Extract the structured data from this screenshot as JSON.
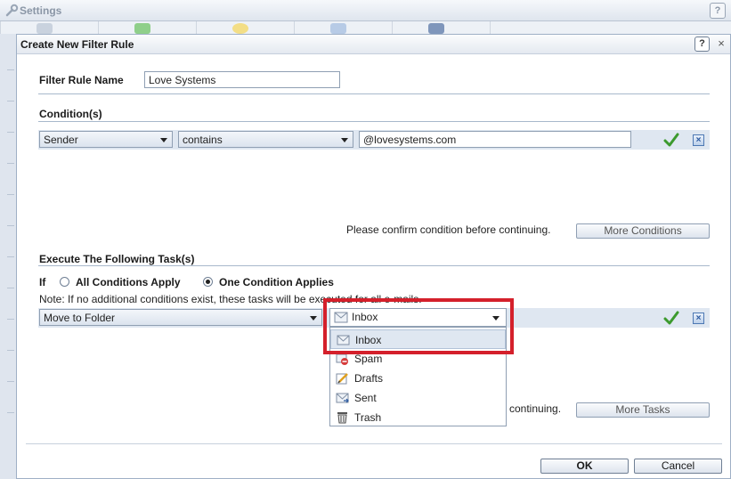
{
  "background_window": {
    "title": "Settings",
    "help_label": "?"
  },
  "dialog": {
    "title": "Create New Filter Rule",
    "help_label": "?",
    "close_label": "×"
  },
  "rule_name": {
    "label": "Filter Rule Name",
    "value": "Love Systems"
  },
  "conditions": {
    "heading": "Condition(s)",
    "field_select": "Sender",
    "operator_select": "contains",
    "value": "@lovesystems.com",
    "confirm_note": "Please confirm condition before continuing.",
    "more_button": "More Conditions"
  },
  "tasks": {
    "heading": "Execute The Following Task(s)",
    "if_label": "If",
    "option_all": "All Conditions Apply",
    "option_one": "One Condition Applies",
    "selected_option": "one",
    "note": "Note: If no additional conditions exist, these tasks will be executed for all e-mails.",
    "action_select": "Move to Folder",
    "folder_select": "Inbox",
    "confirm_note_fragment": "continuing.",
    "more_button": "More Tasks"
  },
  "folder_dropdown": {
    "items": [
      {
        "label": "Inbox",
        "icon": "inbox-icon"
      },
      {
        "label": "Spam",
        "icon": "spam-icon"
      },
      {
        "label": "Drafts",
        "icon": "drafts-icon"
      },
      {
        "label": "Sent",
        "icon": "sent-icon"
      },
      {
        "label": "Trash",
        "icon": "trash-icon"
      }
    ],
    "selected": "Inbox"
  },
  "footer": {
    "ok_label": "OK",
    "cancel_label": "Cancel"
  },
  "colors": {
    "highlight": "#d4202b",
    "band": "#dfe7f1",
    "accent_blue": "#2c5aa0",
    "check_green": "#3c9a2e"
  }
}
